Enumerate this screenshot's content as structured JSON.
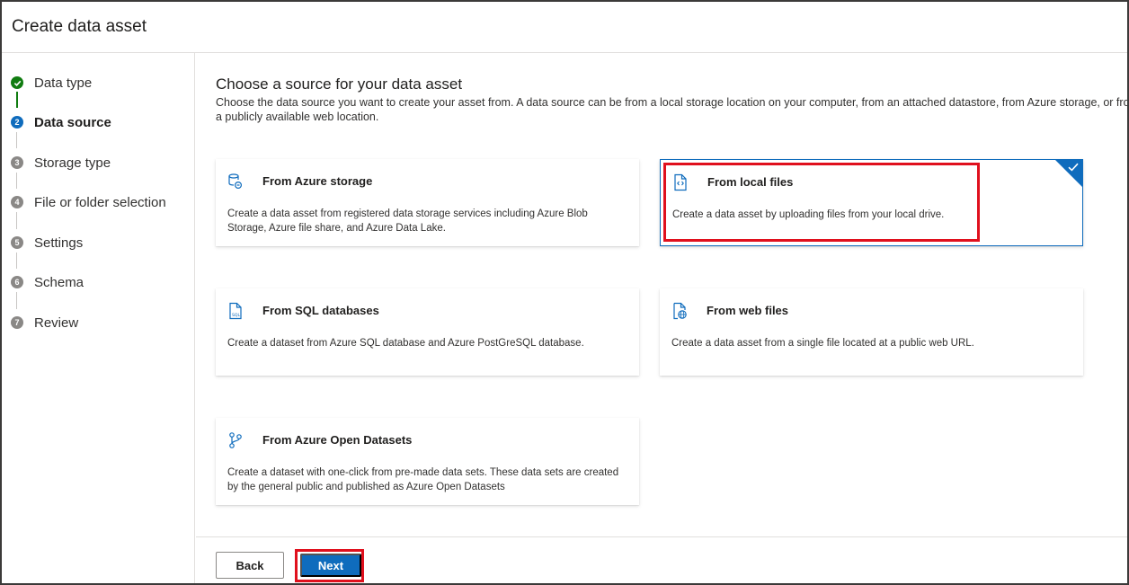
{
  "header": {
    "title": "Create data asset"
  },
  "steps": [
    {
      "label": "Data type",
      "status": "done",
      "number": ""
    },
    {
      "label": "Data source",
      "status": "current",
      "number": "2"
    },
    {
      "label": "Storage type",
      "status": "todo",
      "number": "3"
    },
    {
      "label": "File or folder selection",
      "status": "todo",
      "number": "4"
    },
    {
      "label": "Settings",
      "status": "todo",
      "number": "5"
    },
    {
      "label": "Schema",
      "status": "todo",
      "number": "6"
    },
    {
      "label": "Review",
      "status": "todo",
      "number": "7"
    }
  ],
  "main": {
    "title": "Choose a source for your data asset",
    "description": "Choose the data source you want to create your asset from. A data source can be from a local storage location on your computer, from an attached datastore, from Azure storage, or from a publicly available web location."
  },
  "sources": [
    {
      "title": "From Azure storage",
      "description": "Create a data asset from registered data storage services including Azure Blob Storage, Azure file share, and Azure Data Lake.",
      "icon": "storage-icon",
      "selected": false
    },
    {
      "title": "From local files",
      "description": "Create a data asset by uploading files from your local drive.",
      "icon": "local-file-icon",
      "selected": true
    },
    {
      "title": "From SQL databases",
      "description": "Create a dataset from Azure SQL database and Azure PostGreSQL database.",
      "icon": "sql-file-icon",
      "selected": false
    },
    {
      "title": "From web files",
      "description": "Create a data asset from a single file located at a public web URL.",
      "icon": "web-file-icon",
      "selected": false
    },
    {
      "title": "From Azure Open Datasets",
      "description": "Create a dataset with one-click from pre-made data sets. These data sets are created by the general public and published as Azure Open Datasets",
      "icon": "branch-icon",
      "selected": false
    }
  ],
  "footer": {
    "back_label": "Back",
    "next_label": "Next"
  },
  "colors": {
    "accent": "#0f6cbd",
    "done": "#107c10",
    "highlight": "#e0101d"
  }
}
